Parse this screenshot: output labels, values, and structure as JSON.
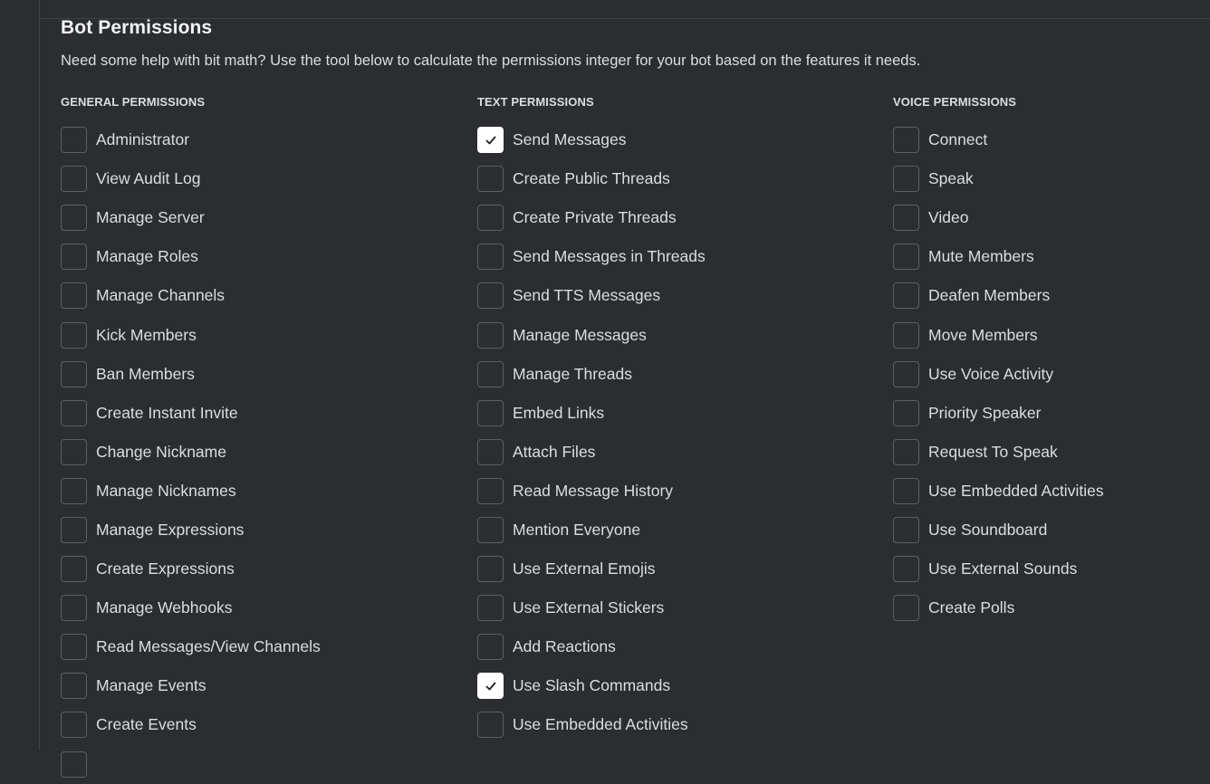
{
  "page": {
    "title": "Bot Permissions",
    "description": "Need some help with bit math? Use the tool below to calculate the permissions integer for your bot based on the features it needs."
  },
  "colors": {
    "background": "#2b2d31",
    "text": "#dbdee1",
    "heading": "#f2f3f5",
    "checkbox_border": "#5c5e66",
    "checkbox_checked": "#ffffff"
  },
  "groups": [
    {
      "header": "GENERAL PERMISSIONS",
      "items": [
        {
          "label": "Administrator",
          "checked": false
        },
        {
          "label": "View Audit Log",
          "checked": false
        },
        {
          "label": "Manage Server",
          "checked": false
        },
        {
          "label": "Manage Roles",
          "checked": false
        },
        {
          "label": "Manage Channels",
          "checked": false
        },
        {
          "label": "Kick Members",
          "checked": false
        },
        {
          "label": "Ban Members",
          "checked": false
        },
        {
          "label": "Create Instant Invite",
          "checked": false
        },
        {
          "label": "Change Nickname",
          "checked": false
        },
        {
          "label": "Manage Nicknames",
          "checked": false
        },
        {
          "label": "Manage Expressions",
          "checked": false
        },
        {
          "label": "Create Expressions",
          "checked": false
        },
        {
          "label": "Manage Webhooks",
          "checked": false
        },
        {
          "label": "Read Messages/View Channels",
          "checked": false
        },
        {
          "label": "Manage Events",
          "checked": false
        },
        {
          "label": "Create Events",
          "checked": false
        },
        {
          "label": "",
          "checked": false
        }
      ]
    },
    {
      "header": "TEXT PERMISSIONS",
      "items": [
        {
          "label": "Send Messages",
          "checked": true
        },
        {
          "label": "Create Public Threads",
          "checked": false
        },
        {
          "label": "Create Private Threads",
          "checked": false
        },
        {
          "label": "Send Messages in Threads",
          "checked": false
        },
        {
          "label": "Send TTS Messages",
          "checked": false
        },
        {
          "label": "Manage Messages",
          "checked": false
        },
        {
          "label": "Manage Threads",
          "checked": false
        },
        {
          "label": "Embed Links",
          "checked": false
        },
        {
          "label": "Attach Files",
          "checked": false
        },
        {
          "label": "Read Message History",
          "checked": false
        },
        {
          "label": "Mention Everyone",
          "checked": false
        },
        {
          "label": "Use External Emojis",
          "checked": false
        },
        {
          "label": "Use External Stickers",
          "checked": false
        },
        {
          "label": "Add Reactions",
          "checked": false
        },
        {
          "label": "Use Slash Commands",
          "checked": true
        },
        {
          "label": "Use Embedded Activities",
          "checked": false
        }
      ]
    },
    {
      "header": "VOICE PERMISSIONS",
      "items": [
        {
          "label": "Connect",
          "checked": false
        },
        {
          "label": "Speak",
          "checked": false
        },
        {
          "label": "Video",
          "checked": false
        },
        {
          "label": "Mute Members",
          "checked": false
        },
        {
          "label": "Deafen Members",
          "checked": false
        },
        {
          "label": "Move Members",
          "checked": false
        },
        {
          "label": "Use Voice Activity",
          "checked": false
        },
        {
          "label": "Priority Speaker",
          "checked": false
        },
        {
          "label": "Request To Speak",
          "checked": false
        },
        {
          "label": "Use Embedded Activities",
          "checked": false
        },
        {
          "label": "Use Soundboard",
          "checked": false
        },
        {
          "label": "Use External Sounds",
          "checked": false
        },
        {
          "label": "Create Polls",
          "checked": false
        }
      ]
    }
  ]
}
